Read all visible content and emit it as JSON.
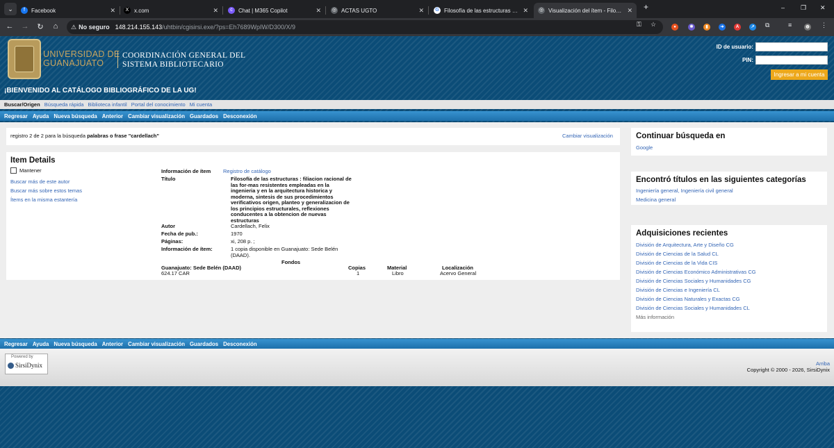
{
  "browser": {
    "tabs": [
      {
        "title": "Facebook",
        "icon": "facebook-icon",
        "color": "#1877f2",
        "glyph": "f"
      },
      {
        "title": "x.com",
        "icon": "x-icon",
        "color": "#000000",
        "glyph": "X"
      },
      {
        "title": "Chat | M365 Copilot",
        "icon": "copilot-icon",
        "color": "#7b5cff",
        "glyph": "c"
      },
      {
        "title": "ACTAS UGTO",
        "icon": "globe-icon",
        "color": "#5f6368",
        "glyph": "◎"
      },
      {
        "title": "Filosofía de las estructuras - Fel",
        "icon": "google-icon",
        "color": "#ffffff",
        "glyph": "G"
      },
      {
        "title": "Visualización del ítem - Filosofía",
        "icon": "globe-icon",
        "color": "#5f6368",
        "glyph": "◎"
      }
    ],
    "address": {
      "security_label": "No seguro",
      "host": "148.214.155.143",
      "path": "/uhtbin/cgisirsi.exe/?ps=Eh7689WpIW/D300/X/9"
    }
  },
  "header": {
    "university_line1": "UNIVERSIDAD DE",
    "university_line2": "GUANAJUATO",
    "coord_line1": "COORDINACIÓN GENERAL DEL",
    "coord_line2": "SISTEMA BIBLIOTECARIO",
    "welcome": "¡BIENVENIDO AL CATÁLOGO BIBLIOGRÁFICO DE LA UG!",
    "user_id_label": "ID de usuario:",
    "pin_label": "PIN:",
    "login_button": "Ingresar a mi cuenta"
  },
  "subnav": {
    "current": "Buscar/Origen",
    "links": [
      "Búsqueda rápida",
      "Biblioteca infantil",
      "Portal del conocimiento",
      "Mi cuenta"
    ]
  },
  "nav": [
    "Regresar",
    "Ayuda",
    "Nueva búsqueda",
    "Anterior",
    "Cambiar visualización",
    "Guardados",
    "Desconexión"
  ],
  "result": {
    "prefix": "registro 2 de 2 para la búsqueda ",
    "query_type": "palabras o frase",
    "query": "\"cardellach\"",
    "change_view": "Cambiar visualización"
  },
  "item": {
    "heading": "Item Details",
    "keep_label": "Mantener",
    "side_links": [
      "Buscar más de este autor",
      "Buscar más sobre estos temas",
      "Ítems en la misma estantería"
    ],
    "info_label": "Información de ítem",
    "catalog_link": "Registro de catálogo",
    "title_label": "Título",
    "title_lines": [
      "Filosofía de las estructuras : filiacion racional de",
      "las for-mas resistentes empleadas en la",
      "ingenieria y en la arquitectura historica y",
      "moderna, sintesis de sus procedimientos",
      "verificativos origen, planteo y generalizacion de",
      "los principios estructurales, reflexiones",
      "conducentes a la obtencion de nuevas",
      "estructuras"
    ],
    "author_label": "Autor",
    "author": "Cardellach, Felix",
    "pubdate_label": "Fecha de pub.:",
    "pubdate": "1970",
    "pages_label": "Páginas:",
    "pages": "xi, 208 p. ;",
    "item_info_label": "Información de ítem:",
    "item_info_lines": [
      "1 copia disponible en Guanajuato: Sede Belén",
      "(DAAD)."
    ],
    "holdings_title": "Fondos",
    "holdings_location_label": "Guanajuato: Sede Belén (DAAD)",
    "call_number": "624.17 CAR",
    "col_copies": "Copias",
    "col_material": "Material",
    "col_location": "Localización",
    "copies": "1",
    "material": "Libro",
    "location": "Acervo General"
  },
  "sidebar": {
    "continue_heading": "Continuar búsqueda en",
    "continue_links": [
      "Google"
    ],
    "categories_heading": "Encontró títulos en las siguientes categorías",
    "categories": [
      "Ingeniería general, Ingeniería civil general",
      "Medicina general"
    ],
    "recent_heading": "Adquisiciones recientes",
    "recent": [
      "División de Arquitectura, Arte y Diseño CG",
      "División de Ciencias de la Salud CL",
      "División de Ciencias de la Vida CIS",
      "División de Ciencias Económico Administrativas CG",
      "División de Ciencias Sociales y Humanidades CG",
      "División de Ciencias e Ingeniería CL",
      "División de Ciencias Naturales y Exactas CG",
      "División de Ciencias Sociales y Humanidades CL"
    ],
    "more": "Más información"
  },
  "footer": {
    "powered_by": "Powered by",
    "brand": "SirsiDynix",
    "top_link": "Arriba",
    "copyright": "Copyright © 2000 - 2026, SirsiDynix"
  }
}
